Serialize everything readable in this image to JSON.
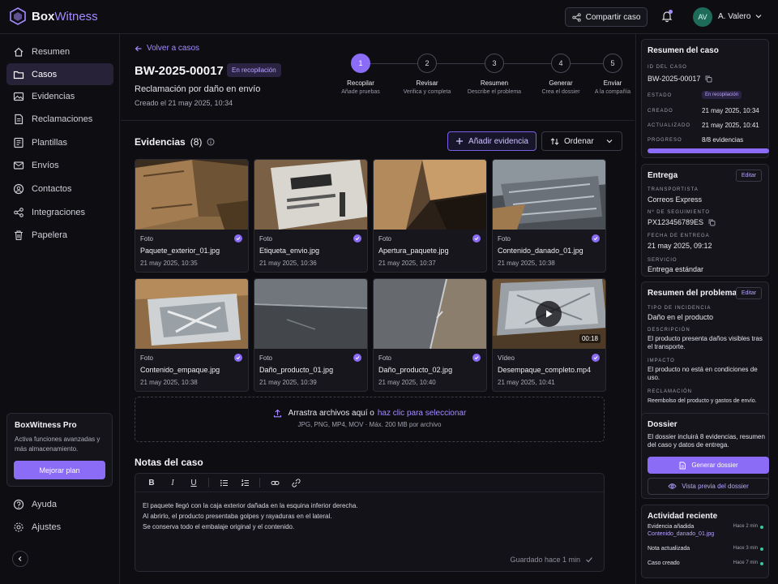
{
  "app": {
    "name_part1": "Box",
    "name_part2": "Witness"
  },
  "topbar": {
    "share_label": "Compartir caso",
    "user_initials": "AV",
    "user_name": "A. Valero"
  },
  "sidebar": {
    "items": [
      {
        "label": "Resumen",
        "icon": "home-icon"
      },
      {
        "label": "Casos",
        "icon": "folder-icon",
        "active": true
      },
      {
        "label": "Evidencias",
        "icon": "image-icon"
      },
      {
        "label": "Reclamaciones",
        "icon": "document-icon"
      },
      {
        "label": "Plantillas",
        "icon": "template-icon"
      },
      {
        "label": "Envíos",
        "icon": "truck-icon"
      },
      {
        "label": "Contactos",
        "icon": "user-icon"
      },
      {
        "label": "Integraciones",
        "icon": "integration-icon"
      },
      {
        "label": "Papelera",
        "icon": "trash-icon"
      }
    ],
    "pro": {
      "title": "BoxWitness Pro",
      "desc": "Activa funciones avanzadas y más almacenamiento.",
      "button": "Mejorar plan"
    },
    "help": "Ayuda",
    "settings": "Ajustes"
  },
  "case": {
    "back": "Volver a casos",
    "id": "BW-2025-00017",
    "status": "En recopilación",
    "subtitle": "Reclamación por daño en envío",
    "created": "Creado el 21 may 2025, 10:34"
  },
  "steps": [
    {
      "n": "1",
      "title": "Recopilar",
      "desc": "Añade pruebas"
    },
    {
      "n": "2",
      "title": "Revisar",
      "desc": "Verifica y completa"
    },
    {
      "n": "3",
      "title": "Resumen",
      "desc": "Describe el problema"
    },
    {
      "n": "4",
      "title": "Generar",
      "desc": "Crea el dossier"
    },
    {
      "n": "5",
      "title": "Enviar",
      "desc": "A la compañía"
    }
  ],
  "evidence": {
    "title": "Evidencias",
    "count": "(8)",
    "add_label": "Añadir evidencia",
    "sort_label": "Ordenar",
    "items": [
      {
        "type": "Foto",
        "name": "Paquete_exterior_01.jpg",
        "date": "21 may 2025, 10:35"
      },
      {
        "type": "Foto",
        "name": "Etiqueta_envio.jpg",
        "date": "21 may 2025, 10:36"
      },
      {
        "type": "Foto",
        "name": "Apertura_paquete.jpg",
        "date": "21 may 2025, 10:37"
      },
      {
        "type": "Foto",
        "name": "Contenido_danado_01.jpg",
        "date": "21 may 2025, 10:38"
      },
      {
        "type": "Foto",
        "name": "Contenido_empaque.jpg",
        "date": "21 may 2025, 10:38"
      },
      {
        "type": "Foto",
        "name": "Daño_producto_01.jpg",
        "date": "21 may 2025, 10:39"
      },
      {
        "type": "Foto",
        "name": "Daño_producto_02.jpg",
        "date": "21 may 2025, 10:40"
      },
      {
        "type": "Vídeo",
        "name": "Desempaque_completo.mp4",
        "date": "21 may 2025, 10:41",
        "duration": "00:18"
      }
    ]
  },
  "upload": {
    "text": "Arrastra archivos aquí o",
    "link": "haz clic para seleccionar",
    "hint": "JPG, PNG, MP4, MOV · Máx. 200 MB por archivo"
  },
  "notes": {
    "title": "Notas del caso",
    "toolbar": [
      "B",
      "I",
      "U"
    ],
    "lines": [
      "El paquete llegó con la caja exterior dañada en la esquina inferior derecha.",
      "Al abrirlo, el producto presentaba golpes y rayaduras en el lateral.",
      "Se conserva todo el embalaje original y el contenido."
    ],
    "saved": "Guardado hace 1 min"
  },
  "summary": {
    "title": "Resumen del caso",
    "id_label": "ID DEL CASO",
    "id": "BW-2025-00017",
    "state_label": "ESTADO",
    "state": "En recopilación",
    "created_label": "CREADO",
    "created": "21 may 2025, 10:34",
    "updated_label": "ACTUALIZADO",
    "updated": "21 may 2025, 10:41",
    "progress_label": "PROGRESO",
    "progress": "8/8 evidencias",
    "progress_fraction": 1.0
  },
  "delivery": {
    "title": "Entrega",
    "edit": "Editar",
    "carrier_label": "TRANSPORTISTA",
    "carrier": "Correos Express",
    "tracking_label": "Nº DE SEGUIMIENTO",
    "tracking": "PX123456789ES",
    "date_label": "FECHA DE ENTREGA",
    "date": "21 may 2025, 09:12",
    "service_label": "SERVICIO",
    "service": "Entrega estándar"
  },
  "problem": {
    "title": "Resumen del problema",
    "edit": "Editar",
    "type_label": "TIPO DE INCIDENCIA",
    "type": "Daño en el producto",
    "desc_label": "DESCRIPCIÓN",
    "desc": "El producto presenta daños visibles tras el transporte.",
    "impact_label": "IMPACTO",
    "impact": "El producto no está en condiciones de uso.",
    "claim_label": "RECLAMACIÓN",
    "claim": "Reembolso del producto y gastos de envío."
  },
  "dossier": {
    "title": "Dossier",
    "desc": "El dossier incluirá 8 evidencias, resumen del caso y datos de entrega.",
    "generate": "Generar dossier",
    "preview": "Vista previa del dossier"
  },
  "activity": {
    "title": "Actividad reciente",
    "items": [
      {
        "text": "Evidencia añadida",
        "file": "Contenido_danado_01.jpg",
        "time": "Hace 2 min"
      },
      {
        "text": "Nota actualizada",
        "time": "Hace 3 min"
      },
      {
        "text": "Caso creado",
        "time": "Hace 7 min"
      }
    ]
  },
  "colors": {
    "accent": "#8b6cf6",
    "success": "#38c79a",
    "background": "#0d0d12"
  }
}
